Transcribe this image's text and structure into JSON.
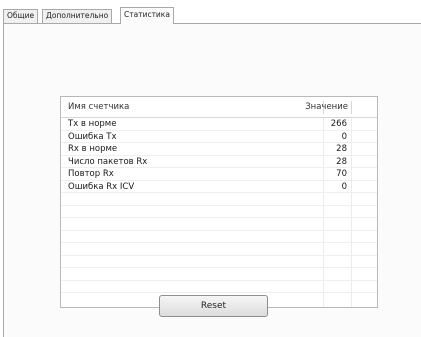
{
  "tabs": [
    {
      "label": "Общие"
    },
    {
      "label": "Дополнительно"
    },
    {
      "label": "Статистика"
    }
  ],
  "table": {
    "headers": {
      "name": "Имя счетчика",
      "value": "Значение"
    },
    "rows": [
      {
        "name": "Tx в норме",
        "value": "266"
      },
      {
        "name": "Ошибка Tx",
        "value": "0"
      },
      {
        "name": "Rx в норме",
        "value": "28"
      },
      {
        "name": "Число пакетов Rx",
        "value": "28"
      },
      {
        "name": "Повтор Rx",
        "value": "70"
      },
      {
        "name": "Ошибка Rx ICV",
        "value": "0"
      }
    ]
  },
  "reset_button": {
    "label": "Reset"
  }
}
